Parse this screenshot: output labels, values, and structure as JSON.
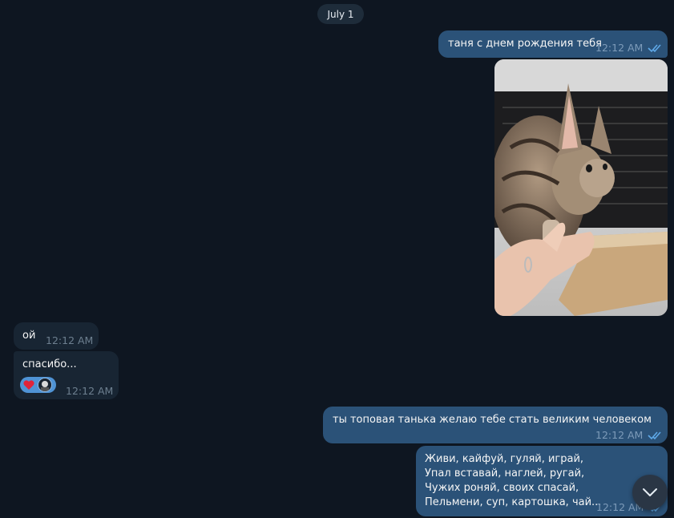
{
  "date_divider": "July 1",
  "messages": [
    {
      "direction": "out",
      "text": "таня с днем рождения тебя",
      "time": "12:12 AM",
      "status": "read"
    },
    {
      "direction": "out",
      "type": "photo",
      "subject": "kitten-photo",
      "time": ""
    },
    {
      "direction": "in",
      "text": "ой",
      "time": "12:12 AM"
    },
    {
      "direction": "in",
      "text": "спасибо...",
      "time": "12:12 AM",
      "reaction": "heart"
    },
    {
      "direction": "out",
      "text": "ты топовая танька желаю тебе стать великим человеком",
      "time": "12:12 AM",
      "status": "read"
    },
    {
      "direction": "out",
      "lines": [
        "Живи, кайфуй, гуляй, играй,",
        "Упал вставай, наглей, ругай,",
        "Чужих роняй, своих спасай,",
        "Пельмени, суп, картошка, чай..."
      ],
      "time": "12:12 AM",
      "status": "read"
    }
  ],
  "colors": {
    "background": "#0e1621",
    "outgoing_bubble": "#2b5278",
    "incoming_bubble": "#182533",
    "read_ticks": "#5fa9e8"
  },
  "icons": {
    "scroll_down": "chevron-down-icon",
    "read_status": "double-check-icon"
  }
}
